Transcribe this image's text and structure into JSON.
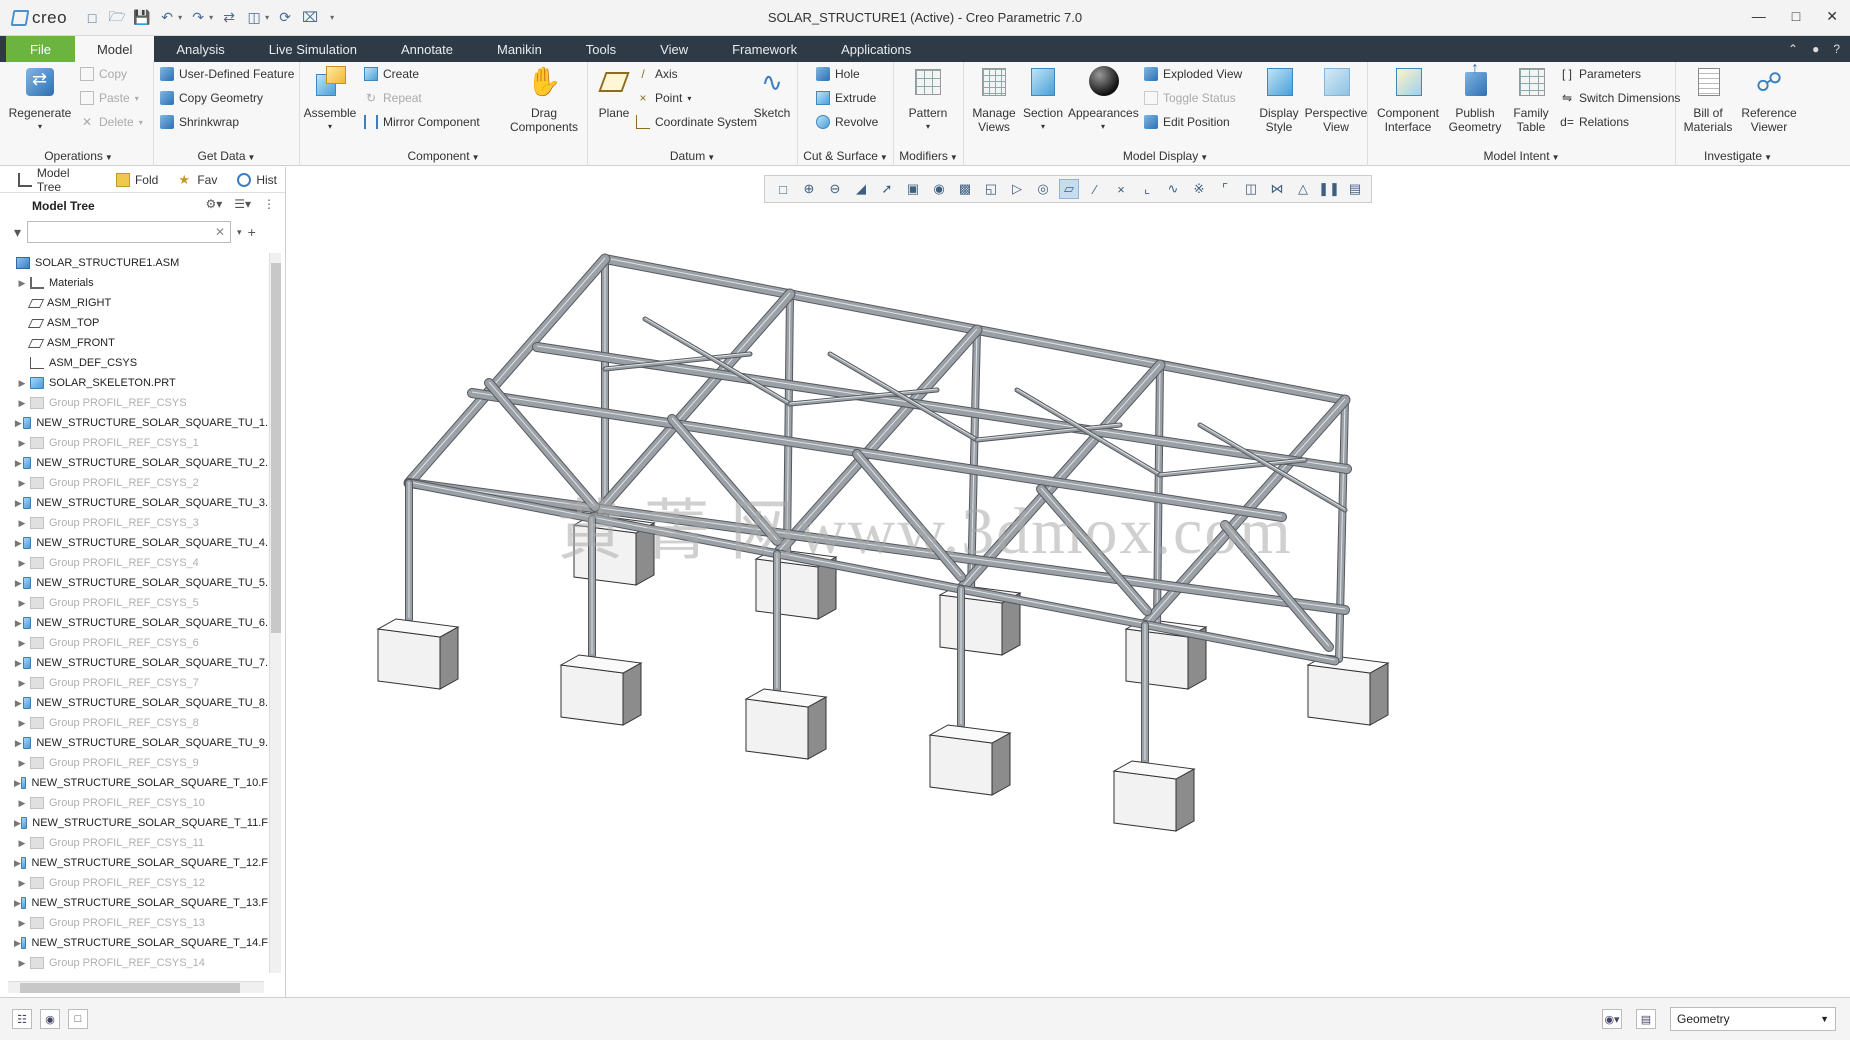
{
  "app": {
    "logo_text": "creo",
    "window_title": "SOLAR_STRUCTURE1 (Active) - Creo Parametric 7.0"
  },
  "ribbon_tabs": [
    "File",
    "Model",
    "Analysis",
    "Live Simulation",
    "Annotate",
    "Manikin",
    "Tools",
    "View",
    "Framework",
    "Applications"
  ],
  "active_tab": "Model",
  "groups": {
    "operations": {
      "title": "Operations",
      "regenerate": "Regenerate",
      "copy": "Copy",
      "paste": "Paste",
      "delete": "Delete"
    },
    "get_data": {
      "title": "Get Data",
      "user_defined_feature": "User-Defined Feature",
      "copy_geometry": "Copy Geometry",
      "shrinkwrap": "Shrinkwrap"
    },
    "component": {
      "title": "Component",
      "assemble": "Assemble",
      "create": "Create",
      "repeat": "Repeat",
      "mirror_component": "Mirror Component",
      "drag_components": "Drag Components"
    },
    "datum": {
      "title": "Datum",
      "plane": "Plane",
      "axis": "Axis",
      "point": "Point",
      "coordinate_system": "Coordinate System",
      "sketch": "Sketch"
    },
    "cut_surface": {
      "title": "Cut & Surface",
      "hole": "Hole",
      "extrude": "Extrude",
      "revolve": "Revolve"
    },
    "modifiers": {
      "title": "Modifiers",
      "pattern": "Pattern"
    },
    "model_display": {
      "title": "Model Display",
      "manage_views": "Manage Views",
      "section": "Section",
      "appearances": "Appearances",
      "exploded_view": "Exploded View",
      "toggle_status": "Toggle Status",
      "edit_position": "Edit Position",
      "display_style": "Display Style",
      "perspective_view": "Perspective View"
    },
    "model_intent": {
      "title": "Model Intent",
      "component_interface": "Component Interface",
      "publish_geometry": "Publish Geometry",
      "family_table": "Family Table",
      "parameters": "Parameters",
      "switch_dimensions": "Switch Dimensions",
      "relations": "Relations"
    },
    "investigate": {
      "title": "Investigate",
      "bill_of_materials": "Bill of Materials",
      "reference_viewer": "Reference Viewer"
    }
  },
  "panel_tabs": [
    "Model Tree",
    "Fold",
    "Fav",
    "Hist"
  ],
  "model_tree": {
    "title": "Model Tree",
    "search_placeholder": "",
    "items": [
      {
        "label": "SOLAR_STRUCTURE1.ASM",
        "type": "asm",
        "expand": false,
        "grey": false,
        "indent": 0
      },
      {
        "label": "Materials",
        "type": "mat",
        "expand": true,
        "grey": false,
        "indent": 1
      },
      {
        "label": "ASM_RIGHT",
        "type": "dtm",
        "expand": false,
        "grey": false,
        "indent": 1
      },
      {
        "label": "ASM_TOP",
        "type": "dtm",
        "expand": false,
        "grey": false,
        "indent": 1
      },
      {
        "label": "ASM_FRONT",
        "type": "dtm",
        "expand": false,
        "grey": false,
        "indent": 1
      },
      {
        "label": "ASM_DEF_CSYS",
        "type": "csys",
        "expand": false,
        "grey": false,
        "indent": 1
      },
      {
        "label": "SOLAR_SKELETON.PRT",
        "type": "prt",
        "expand": true,
        "grey": false,
        "indent": 1
      },
      {
        "label": "Group PROFIL_REF_CSYS",
        "type": "grp",
        "expand": true,
        "grey": true,
        "indent": 1
      },
      {
        "label": "NEW_STRUCTURE_SOLAR_SQUARE_TU_1.",
        "type": "prt",
        "expand": true,
        "grey": false,
        "indent": 1
      },
      {
        "label": "Group PROFIL_REF_CSYS_1",
        "type": "grp",
        "expand": true,
        "grey": true,
        "indent": 1
      },
      {
        "label": "NEW_STRUCTURE_SOLAR_SQUARE_TU_2.",
        "type": "prt",
        "expand": true,
        "grey": false,
        "indent": 1
      },
      {
        "label": "Group PROFIL_REF_CSYS_2",
        "type": "grp",
        "expand": true,
        "grey": true,
        "indent": 1
      },
      {
        "label": "NEW_STRUCTURE_SOLAR_SQUARE_TU_3.",
        "type": "prt",
        "expand": true,
        "grey": false,
        "indent": 1
      },
      {
        "label": "Group PROFIL_REF_CSYS_3",
        "type": "grp",
        "expand": true,
        "grey": true,
        "indent": 1
      },
      {
        "label": "NEW_STRUCTURE_SOLAR_SQUARE_TU_4.",
        "type": "prt",
        "expand": true,
        "grey": false,
        "indent": 1
      },
      {
        "label": "Group PROFIL_REF_CSYS_4",
        "type": "grp",
        "expand": true,
        "grey": true,
        "indent": 1
      },
      {
        "label": "NEW_STRUCTURE_SOLAR_SQUARE_TU_5.",
        "type": "prt",
        "expand": true,
        "grey": false,
        "indent": 1
      },
      {
        "label": "Group PROFIL_REF_CSYS_5",
        "type": "grp",
        "expand": true,
        "grey": true,
        "indent": 1
      },
      {
        "label": "NEW_STRUCTURE_SOLAR_SQUARE_TU_6.",
        "type": "prt",
        "expand": true,
        "grey": false,
        "indent": 1
      },
      {
        "label": "Group PROFIL_REF_CSYS_6",
        "type": "grp",
        "expand": true,
        "grey": true,
        "indent": 1
      },
      {
        "label": "NEW_STRUCTURE_SOLAR_SQUARE_TU_7.",
        "type": "prt",
        "expand": true,
        "grey": false,
        "indent": 1
      },
      {
        "label": "Group PROFIL_REF_CSYS_7",
        "type": "grp",
        "expand": true,
        "grey": true,
        "indent": 1
      },
      {
        "label": "NEW_STRUCTURE_SOLAR_SQUARE_TU_8.",
        "type": "prt",
        "expand": true,
        "grey": false,
        "indent": 1
      },
      {
        "label": "Group PROFIL_REF_CSYS_8",
        "type": "grp",
        "expand": true,
        "grey": true,
        "indent": 1
      },
      {
        "label": "NEW_STRUCTURE_SOLAR_SQUARE_TU_9.",
        "type": "prt",
        "expand": true,
        "grey": false,
        "indent": 1
      },
      {
        "label": "Group PROFIL_REF_CSYS_9",
        "type": "grp",
        "expand": true,
        "grey": true,
        "indent": 1
      },
      {
        "label": "NEW_STRUCTURE_SOLAR_SQUARE_T_10.F",
        "type": "prt",
        "expand": true,
        "grey": false,
        "indent": 1
      },
      {
        "label": "Group PROFIL_REF_CSYS_10",
        "type": "grp",
        "expand": true,
        "grey": true,
        "indent": 1
      },
      {
        "label": "NEW_STRUCTURE_SOLAR_SQUARE_T_11.F",
        "type": "prt",
        "expand": true,
        "grey": false,
        "indent": 1
      },
      {
        "label": "Group PROFIL_REF_CSYS_11",
        "type": "grp",
        "expand": true,
        "grey": true,
        "indent": 1
      },
      {
        "label": "NEW_STRUCTURE_SOLAR_SQUARE_T_12.F",
        "type": "prt",
        "expand": true,
        "grey": false,
        "indent": 1
      },
      {
        "label": "Group PROFIL_REF_CSYS_12",
        "type": "grp",
        "expand": true,
        "grey": true,
        "indent": 1
      },
      {
        "label": "NEW_STRUCTURE_SOLAR_SQUARE_T_13.F",
        "type": "prt",
        "expand": true,
        "grey": false,
        "indent": 1
      },
      {
        "label": "Group PROFIL_REF_CSYS_13",
        "type": "grp",
        "expand": true,
        "grey": true,
        "indent": 1
      },
      {
        "label": "NEW_STRUCTURE_SOLAR_SQUARE_T_14.F",
        "type": "prt",
        "expand": true,
        "grey": false,
        "indent": 1
      },
      {
        "label": "Group PROFIL_REF_CSYS_14",
        "type": "grp",
        "expand": true,
        "grey": true,
        "indent": 1
      }
    ]
  },
  "graphics": {
    "watermark": "黄 菁 网www.3dmox.com"
  },
  "status_bar": {
    "selection_filter": "Geometry"
  },
  "colors": {
    "file_tab": "#6bb43f",
    "tab_bar": "#2e3a46",
    "structure_steel": "#9aa0a6",
    "foundation_block": "#f2f2f2"
  }
}
